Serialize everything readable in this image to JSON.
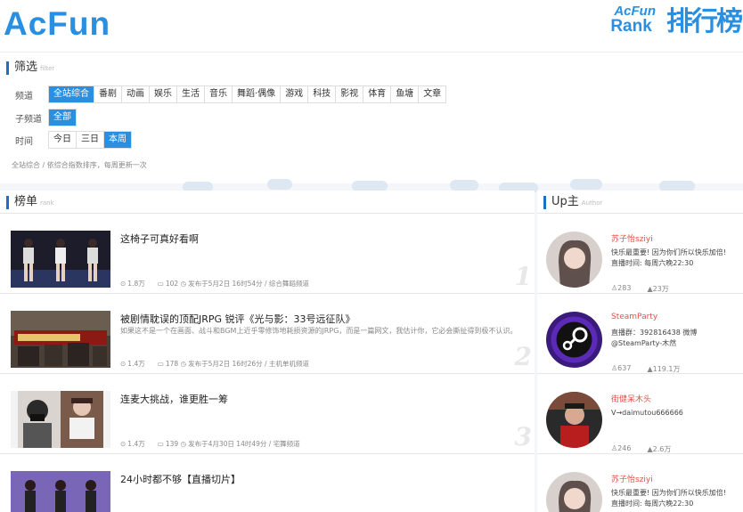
{
  "header": {
    "logo": "AcFun",
    "rank_en_1": "AcFun",
    "rank_en_2": "Rank",
    "rank_cn": "排行榜"
  },
  "filter": {
    "title": "筛选",
    "title_en": "filter",
    "channel_label": "频道",
    "channels": [
      "全站综合",
      "番剧",
      "动画",
      "娱乐",
      "生活",
      "音乐",
      "舞蹈·偶像",
      "游戏",
      "科技",
      "影视",
      "体育",
      "鱼塘",
      "文章"
    ],
    "sub_label": "子频道",
    "subs": [
      "全部"
    ],
    "time_label": "时间",
    "times": [
      "今日",
      "三日",
      "本周"
    ],
    "note": "全站综合 / 依综合指数排序，每周更新一次"
  },
  "ranklist": {
    "title": "榜单",
    "title_en": "rank",
    "items": [
      {
        "title": "这椅子可真好看啊",
        "desc": "",
        "views": "1.8万",
        "comments": "102",
        "pub": "发布于5月2日 16时54分 / 综合舞蹈频道",
        "num": "1"
      },
      {
        "title": "被剧情耽误的顶配JRPG 锐评《光与影：33号远征队》",
        "desc": "如果这不是一个在画面、战斗和BGM上近乎零修饰地耗损资源的JRPG，而是一篇网文，我估计你，它必会撕扯得到极不认识。",
        "views": "1.4万",
        "comments": "178",
        "pub": "发布于5月2日 16时26分 / 主机单机频道",
        "num": "2"
      },
      {
        "title": "连麦大挑战，谁更胜一筹",
        "desc": "",
        "views": "1.4万",
        "comments": "139",
        "pub": "发布于4月30日 14时49分 / 宅舞频道",
        "num": "3"
      },
      {
        "title": "24小时都不够【直播切片】",
        "desc": "",
        "views": "",
        "comments": "",
        "pub": "",
        "num": ""
      }
    ]
  },
  "authors": {
    "title": "Up主",
    "title_en": "Author",
    "items": [
      {
        "name": "苏子怡sziyi",
        "desc": "快乐最重要! 因为你们所以快乐加倍! 直播时间: 每周六晚22:30",
        "fans": "283",
        "likes": "23万"
      },
      {
        "name": "SteamParty",
        "desc": "直播群：392816438 微博@SteamParty-木然",
        "fans": "637",
        "likes": "119.1万"
      },
      {
        "name": "街健呆木头",
        "desc": "V→daimutou666666",
        "fans": "246",
        "likes": "2.6万"
      },
      {
        "name": "苏子怡sziyi",
        "desc": "快乐最重要! 因为你们所以快乐加倍! 直播时间: 每周六晚22:30",
        "fans": "",
        "likes": ""
      }
    ]
  },
  "colors": {
    "accent": "#2a8fe0",
    "author_name": "#e0524a"
  }
}
